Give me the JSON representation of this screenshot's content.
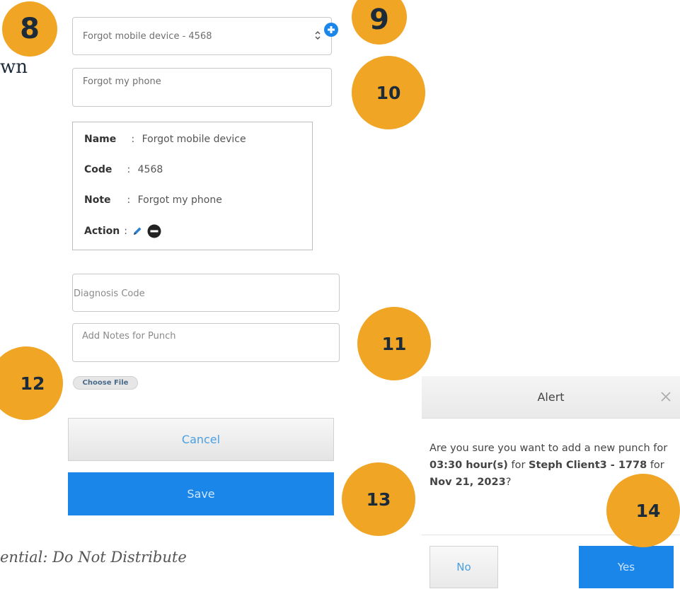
{
  "badges": {
    "b8": "8",
    "b9": "9",
    "b10": "10",
    "b11": "11",
    "b12": "12",
    "b13": "13",
    "b14": "14"
  },
  "left_fragment": "wn",
  "form": {
    "reason_select": "Forgot mobile device - 4568",
    "reason_note": "Forgot my phone",
    "card": {
      "name_label": "Name",
      "name_value": "Forgot mobile device",
      "code_label": "Code",
      "code_value": "4568",
      "note_label": "Note",
      "note_value": "Forgot my phone",
      "action_label": "Action"
    },
    "separator": ":",
    "diagnosis_placeholder": "Diagnosis Code",
    "notes_placeholder": "Add Notes for Punch",
    "choose_file": "Choose File",
    "cancel": "Cancel",
    "save": "Save"
  },
  "footer_text": "ential: Do Not Distribute",
  "alert": {
    "title": "Alert",
    "msg_part1": "Are you sure you want to add a new punch for ",
    "msg_hours": "03:30 hour(s)",
    "msg_part2": " for ",
    "msg_client": "Steph Client3 - 1778",
    "msg_part3": " for ",
    "msg_date": "Nov 21, 2023",
    "msg_end": "?",
    "no": "No",
    "yes": "Yes"
  },
  "colors": {
    "badge": "#f0a524",
    "primary": "#1a86ea",
    "link": "#4a9fe0"
  },
  "icons": {
    "add": "plus-circle-icon",
    "select": "updown-chevron-icon",
    "edit": "pencil-icon",
    "remove": "minus-circle-icon",
    "close": "close-icon"
  }
}
